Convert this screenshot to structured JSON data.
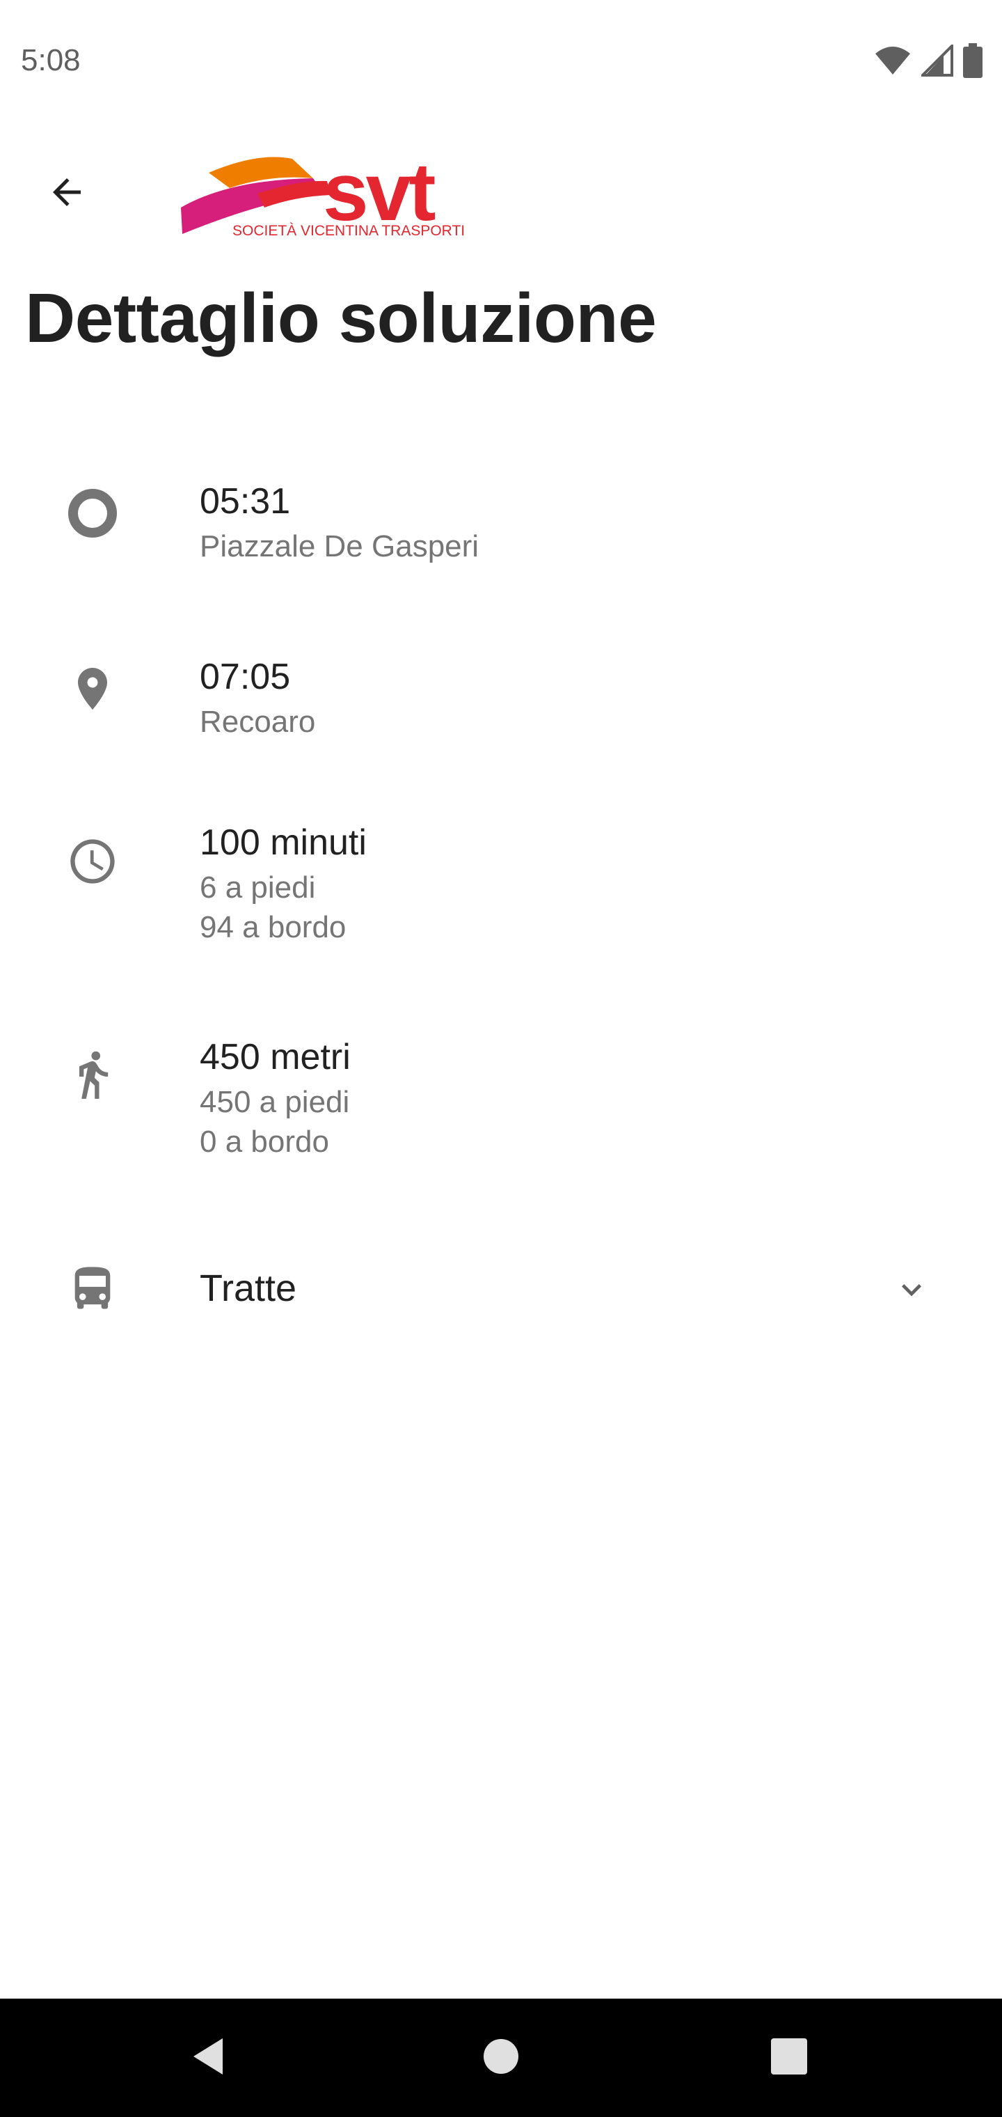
{
  "status_bar": {
    "time": "5:08",
    "icons": [
      "wifi-icon",
      "cell-signal-icon",
      "battery-icon"
    ]
  },
  "app_bar": {
    "back_icon": "arrow-back-icon",
    "logo": {
      "text": "svt",
      "subtitle": "SOCIETÀ VICENTINA TRASPORTI",
      "colors": {
        "red": "#e3262f",
        "orange": "#ef7d00",
        "magenta": "#d51f7a"
      }
    }
  },
  "page": {
    "title": "Dettaglio soluzione"
  },
  "details": {
    "departure": {
      "icon": "circle-outline-icon",
      "time": "05:31",
      "place": "Piazzale De Gasperi"
    },
    "arrival": {
      "icon": "map-pin-icon",
      "time": "07:05",
      "place": "Recoaro"
    },
    "duration": {
      "icon": "clock-icon",
      "total": "100 minuti",
      "walking": "6 a piedi",
      "onboard": "94 a bordo"
    },
    "distance": {
      "icon": "walking-person-icon",
      "total": "450 metri",
      "walking": "450 a piedi",
      "onboard": "0 a bordo"
    },
    "tratte": {
      "icon": "bus-icon",
      "label": "Tratte",
      "expand_icon": "chevron-down-icon"
    }
  },
  "nav_bar": {
    "buttons": [
      "nav-back-icon",
      "nav-home-icon",
      "nav-recents-icon"
    ]
  },
  "colors": {
    "icon_gray": "#757575",
    "text_primary": "#212121",
    "text_secondary": "#757575"
  }
}
